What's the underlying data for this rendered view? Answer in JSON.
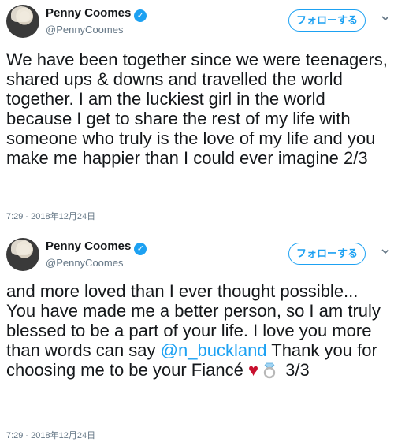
{
  "tweets": [
    {
      "name": "Penny Coomes",
      "handle": "@PennyCoomes",
      "follow_label": "フォローする",
      "text": "We have been together since we were teenagers, shared ups & downs and travelled the world together. I am the luckiest girl in the world because I get to share the rest of my life with someone who truly is the love of my life and you make me happier than I could ever imagine 2/3",
      "timestamp": "7:29 - 2018年12月24日"
    },
    {
      "name": "Penny Coomes",
      "handle": "@PennyCoomes",
      "follow_label": "フォローする",
      "text_before": "and more loved than I ever thought possible... You have made me a better person, so I am truly blessed to be a part of your life. I love you more than words can say ",
      "mention": "@n_buckland",
      "text_after": " Thank you for choosing me to be your Fiancé ",
      "heart": "♥",
      "suffix": " 3/3",
      "timestamp": "7:29 - 2018年12月24日"
    }
  ],
  "icons": {
    "verified": "verified-badge-icon",
    "chevron": "chevron-down-icon",
    "ring": "ring-emoji-icon"
  },
  "colors": {
    "accent": "#1da1f2",
    "text": "#14171a",
    "muted": "#657786",
    "heart": "#c8102e"
  }
}
